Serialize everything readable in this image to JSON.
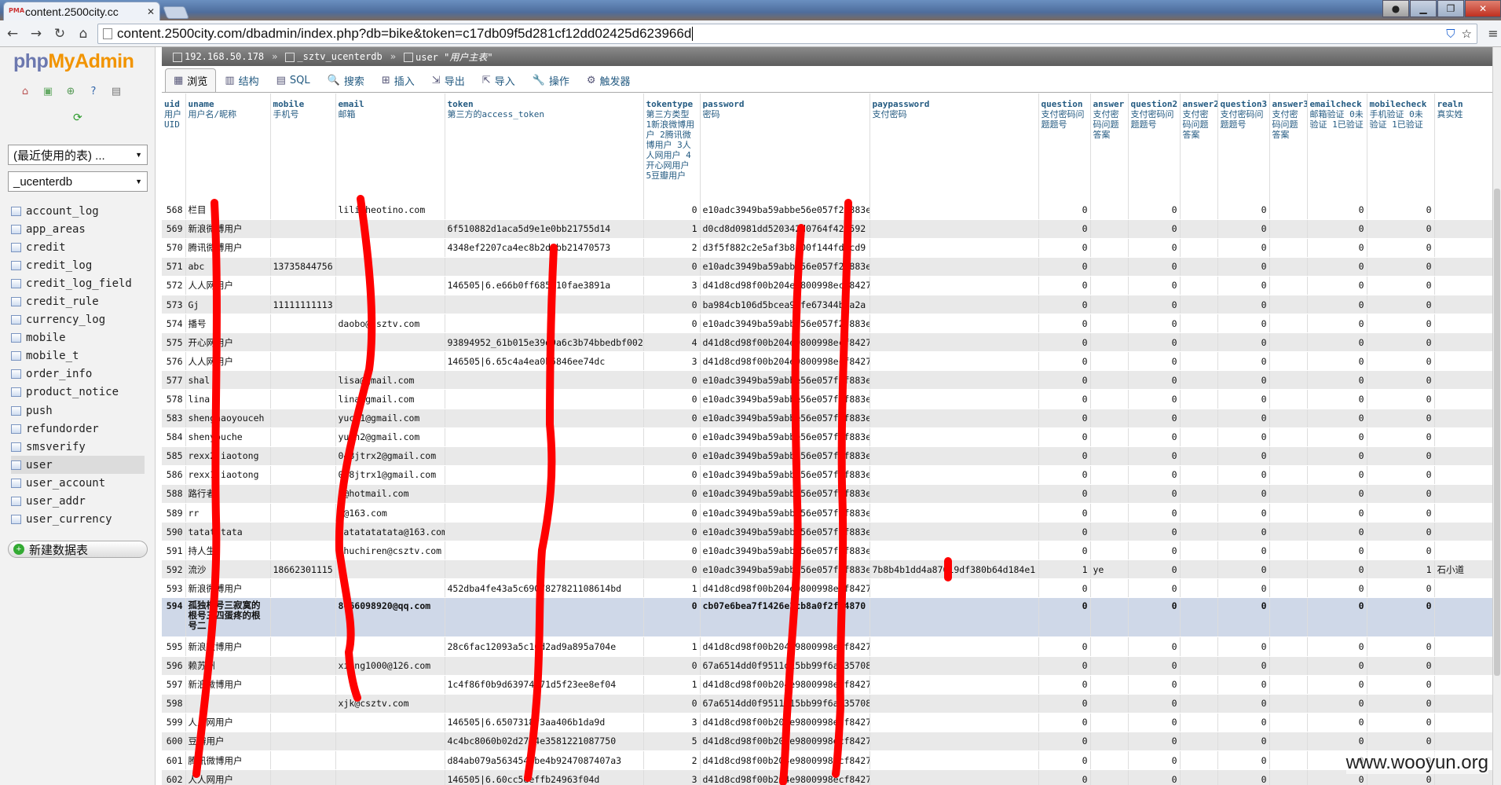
{
  "browser": {
    "tab_title": "content.2500city.cc",
    "tab_icon_label": "PMA",
    "url": "content.2500city.com/dbadmin/index.php?db=bike&token=c17db09f5d281cf12dd02425d623966d",
    "colors": {
      "shield": "#1a5fd0"
    }
  },
  "sidebar": {
    "logo_php": "php",
    "logo_my": "My",
    "logo_admin": "Admin",
    "recent_select": "(最近使用的表) ...",
    "db_select": "_ucenterdb",
    "tables": [
      "account_log",
      "app_areas",
      "credit",
      "credit_log",
      "credit_log_field",
      "credit_rule",
      "currency_log",
      "mobile",
      "mobile_t",
      "order_info",
      "product_notice",
      "push",
      "refundorder",
      "smsverify",
      "user",
      "user_account",
      "user_addr",
      "user_currency"
    ],
    "active_table": "user",
    "new_db": "新建数据表"
  },
  "breadcrumb": {
    "server": "192.168.50.178",
    "database": "_sztv_ucenterdb",
    "table": "user",
    "table_comment": "\"用户主表\""
  },
  "tabs": [
    {
      "label": "浏览",
      "icon": "table-icon",
      "active": true
    },
    {
      "label": "结构",
      "icon": "structure-icon"
    },
    {
      "label": "SQL",
      "icon": "sql-icon"
    },
    {
      "label": "搜索",
      "icon": "search-icon"
    },
    {
      "label": "插入",
      "icon": "insert-icon"
    },
    {
      "label": "导出",
      "icon": "export-icon"
    },
    {
      "label": "导入",
      "icon": "import-icon"
    },
    {
      "label": "操作",
      "icon": "wrench-icon"
    },
    {
      "label": "触发器",
      "icon": "trigger-icon"
    }
  ],
  "columns": [
    {
      "name": "uid",
      "comment": "用户UID"
    },
    {
      "name": "uname",
      "comment": "用户名/昵称"
    },
    {
      "name": "mobile",
      "comment": "手机号"
    },
    {
      "name": "email",
      "comment": "邮箱"
    },
    {
      "name": "token",
      "comment": "第三方的access_token"
    },
    {
      "name": "tokentype",
      "comment": "第三方类型 1新浪微博用户 2腾讯微博用户 3人人网用户 4开心网用户 5豆瓣用户"
    },
    {
      "name": "password",
      "comment": "密码"
    },
    {
      "name": "paypassword",
      "comment": "支付密码"
    },
    {
      "name": "question",
      "comment": "支付密码问题题号"
    },
    {
      "name": "answer",
      "comment": "支付密码问题答案"
    },
    {
      "name": "question2",
      "comment": "支付密码问题题号"
    },
    {
      "name": "answer2",
      "comment": "支付密码问题答案"
    },
    {
      "name": "question3",
      "comment": "支付密码问题题号"
    },
    {
      "name": "answer3",
      "comment": "支付密码问题答案"
    },
    {
      "name": "emailcheck",
      "comment": "邮箱验证 0未验证 1已验证"
    },
    {
      "name": "mobilecheck",
      "comment": "手机验证 0未验证 1已验证"
    },
    {
      "name": "realn",
      "comment": "真实姓"
    }
  ],
  "rows": [
    [
      "568",
      "栏目",
      "",
      "lili@heotino.com",
      "",
      "0",
      "e10adc3949ba59abbe56e057f2f883e",
      "",
      "0",
      "",
      "0",
      "",
      "0",
      "",
      "0",
      "0",
      ""
    ],
    [
      "569",
      "新浪微博用户",
      "",
      "",
      "6f510882d1aca5d9e1e0bb21755d14",
      "1",
      "d0cd8d0981dd520342d0764f42b592",
      "",
      "0",
      "",
      "0",
      "",
      "0",
      "",
      "0",
      "0",
      ""
    ],
    [
      "570",
      "腾讯微博用户",
      "",
      "",
      "4348ef2207ca4ec8b2d2bb21470573",
      "2",
      "d3f5f882c2e5af3b8100f144fd1cd9",
      "",
      "0",
      "",
      "0",
      "",
      "0",
      "",
      "0",
      "0",
      ""
    ],
    [
      "571",
      "abc",
      "13735844756",
      "",
      "",
      "0",
      "e10adc3949ba59abbe56e057f2f883e",
      "",
      "0",
      "",
      "0",
      "",
      "0",
      "",
      "0",
      "0",
      ""
    ],
    [
      "572",
      "人人网用户",
      "",
      "",
      "146505|6.e66b0ff685d10fae3891a",
      "3",
      "d41d8cd98f00b204e9800998ecf8427e",
      "",
      "0",
      "",
      "0",
      "",
      "0",
      "",
      "0",
      "0",
      ""
    ],
    [
      "573",
      "Gj",
      "11111111113",
      "",
      "",
      "0",
      "ba984cb106d5bcea9bfe67344b9a2a",
      "",
      "0",
      "",
      "0",
      "",
      "0",
      "",
      "0",
      "0",
      ""
    ],
    [
      "574",
      "播号",
      "",
      "daobo@csztv.com",
      "",
      "0",
      "e10adc3949ba59abbe56e057f2f883e",
      "",
      "0",
      "",
      "0",
      "",
      "0",
      "",
      "0",
      "0",
      ""
    ],
    [
      "575",
      "开心网用户",
      "",
      "",
      "93894952_61b015e39d9a6c3b74bbedbf0029",
      "4",
      "d41d8cd98f00b204e9800998ecf8427e",
      "",
      "0",
      "",
      "0",
      "",
      "0",
      "",
      "0",
      "0",
      ""
    ],
    [
      "576",
      "人人网用户",
      "",
      "",
      "146505|6.65c4a4ea0b5846ee74dc",
      "3",
      "d41d8cd98f00b204e9800998ecf8427e",
      "",
      "0",
      "",
      "0",
      "",
      "0",
      "",
      "0",
      "0",
      ""
    ],
    [
      "577",
      "shal",
      "",
      "lisa@gmail.com",
      "",
      "0",
      "e10adc3949ba59abbe56e057f2f883e",
      "",
      "0",
      "",
      "0",
      "",
      "0",
      "",
      "0",
      "0",
      ""
    ],
    [
      "578",
      "lina",
      "",
      "lina@gmail.com",
      "",
      "0",
      "e10adc3949ba59abbe56e057f2f883e",
      "",
      "0",
      "",
      "0",
      "",
      "0",
      "",
      "0",
      "0",
      ""
    ],
    [
      "583",
      "shenghaoyouceh",
      "",
      "yuch1@gmail.com",
      "",
      "0",
      "e10adc3949ba59abbe56e057f2f883e",
      "",
      "0",
      "",
      "0",
      "",
      "0",
      "",
      "0",
      "0",
      ""
    ],
    [
      "584",
      "shenyouche",
      "",
      "yuch2@gmail.com",
      "",
      "0",
      "e10adc3949ba59abbe56e057f2f883e",
      "",
      "0",
      "",
      "0",
      "",
      "0",
      "",
      "0",
      "0",
      ""
    ],
    [
      "585",
      "rexx2jiaotong",
      "",
      "048jtrx2@gmail.com",
      "",
      "0",
      "e10adc3949ba59abbe56e057f2f883e",
      "",
      "0",
      "",
      "0",
      "",
      "0",
      "",
      "0",
      "0",
      ""
    ],
    [
      "586",
      "rexx1jiaotong",
      "",
      "048jtrx1@gmail.com",
      "",
      "0",
      "e10adc3949ba59abbe56e057f2f883e",
      "",
      "0",
      "",
      "0",
      "",
      "0",
      "",
      "0",
      "0",
      ""
    ],
    [
      "588",
      "路行者",
      "",
      "1@hotmail.com",
      "",
      "0",
      "e10adc3949ba59abbe56e057f2f883e",
      "",
      "0",
      "",
      "0",
      "",
      "0",
      "",
      "0",
      "0",
      ""
    ],
    [
      "589",
      "rr",
      "",
      "c@163.com",
      "",
      "0",
      "e10adc3949ba59abbe56e057f2f883e",
      "",
      "0",
      "",
      "0",
      "",
      "0",
      "",
      "0",
      "0",
      ""
    ],
    [
      "590",
      "tatatatata",
      "",
      "tatatatatata@163.com",
      "",
      "0",
      "e10adc3949ba59abbe56e057f2f883e",
      "",
      "0",
      "",
      "0",
      "",
      "0",
      "",
      "0",
      "0",
      ""
    ],
    [
      "591",
      "持人生",
      "",
      "zhuchiren@csztv.com",
      "",
      "0",
      "e10adc3949ba59abbe56e057f2f883e",
      "",
      "0",
      "",
      "0",
      "",
      "0",
      "",
      "0",
      "0",
      ""
    ],
    [
      "592",
      "流沙",
      "18662301115",
      "",
      "",
      "0",
      "e10adc3949ba59abbe56e057f2f883e",
      "7b8b4b1dd4a87019df380b64d184e1",
      "1",
      "ye",
      "0",
      "",
      "0",
      "",
      "0",
      "1",
      "石小道"
    ],
    [
      "593",
      "新浪微博用户",
      "",
      "",
      "452dba4fe43a5c6907827821108614bd",
      "1",
      "d41d8cd98f00b204e9800998ecf8427e",
      "",
      "0",
      "",
      "0",
      "",
      "0",
      "",
      "0",
      "0",
      ""
    ],
    [
      "594",
      "孤独根号三寂寞的根号三四蛋疼的根号二",
      "",
      "8066098920@qq.com",
      "",
      "0",
      "cb07e6bea7f1426e3cb8a0f2fa4870",
      "",
      "0",
      "",
      "0",
      "",
      "0",
      "",
      "0",
      "0",
      ""
    ],
    [
      "595",
      "新浪微博用户",
      "",
      "",
      "28c6fac12093a5c10d2ad9a895a704e",
      "1",
      "d41d8cd98f00b204e9800998ecf8427e",
      "",
      "0",
      "",
      "0",
      "",
      "0",
      "",
      "0",
      "0",
      ""
    ],
    [
      "596",
      "赖苏州",
      "",
      "xiang1000@126.com",
      "",
      "0",
      "67a6514dd0f9511d15bb99f6a735708",
      "",
      "0",
      "",
      "0",
      "",
      "0",
      "",
      "0",
      "0",
      ""
    ],
    [
      "597",
      "新浪微博用户",
      "",
      "",
      "1c4f86f0b9d63974b71d5f23ee8ef04",
      "1",
      "d41d8cd98f00b204e9800998ecf8427e",
      "",
      "0",
      "",
      "0",
      "",
      "0",
      "",
      "0",
      "0",
      ""
    ],
    [
      "598",
      "",
      "",
      "xjk@csztv.com",
      "",
      "0",
      "67a6514dd0f9511d15bb99f6a735708",
      "",
      "0",
      "",
      "0",
      "",
      "0",
      "",
      "0",
      "0",
      ""
    ],
    [
      "599",
      "人人网用户",
      "",
      "",
      "146505|6.6507318f3aa406b1da9d",
      "3",
      "d41d8cd98f00b204e9800998ecf8427e",
      "",
      "0",
      "",
      "0",
      "",
      "0",
      "",
      "0",
      "0",
      ""
    ],
    [
      "600",
      "豆瓣用户",
      "",
      "",
      "4c4bc8060b02d27e4e3581221087750",
      "5",
      "d41d8cd98f00b204e9800998ecf8427e",
      "",
      "0",
      "",
      "0",
      "",
      "0",
      "",
      "0",
      "0",
      ""
    ],
    [
      "601",
      "腾讯微博用户",
      "",
      "",
      "d84ab079a5634540be4b9247087407a3",
      "2",
      "d41d8cd98f00b204e9800998ecf8427e",
      "",
      "0",
      "",
      "0",
      "",
      "0",
      "",
      "0",
      "0",
      ""
    ],
    [
      "602",
      "人人网用户",
      "",
      "",
      "146505|6.60cc5deffb24963f04d",
      "3",
      "d41d8cd98f00b204e9800998ecf8427e",
      "",
      "0",
      "",
      "0",
      "",
      "0",
      "",
      "0",
      "0",
      ""
    ]
  ],
  "highlight_row": "594",
  "watermark": "www.wooyun.org",
  "colors": {
    "redaction": "#ff0000",
    "link": "#235a81",
    "row_even": "#e9e9e9",
    "row_highlight": "#cfd8e8"
  }
}
